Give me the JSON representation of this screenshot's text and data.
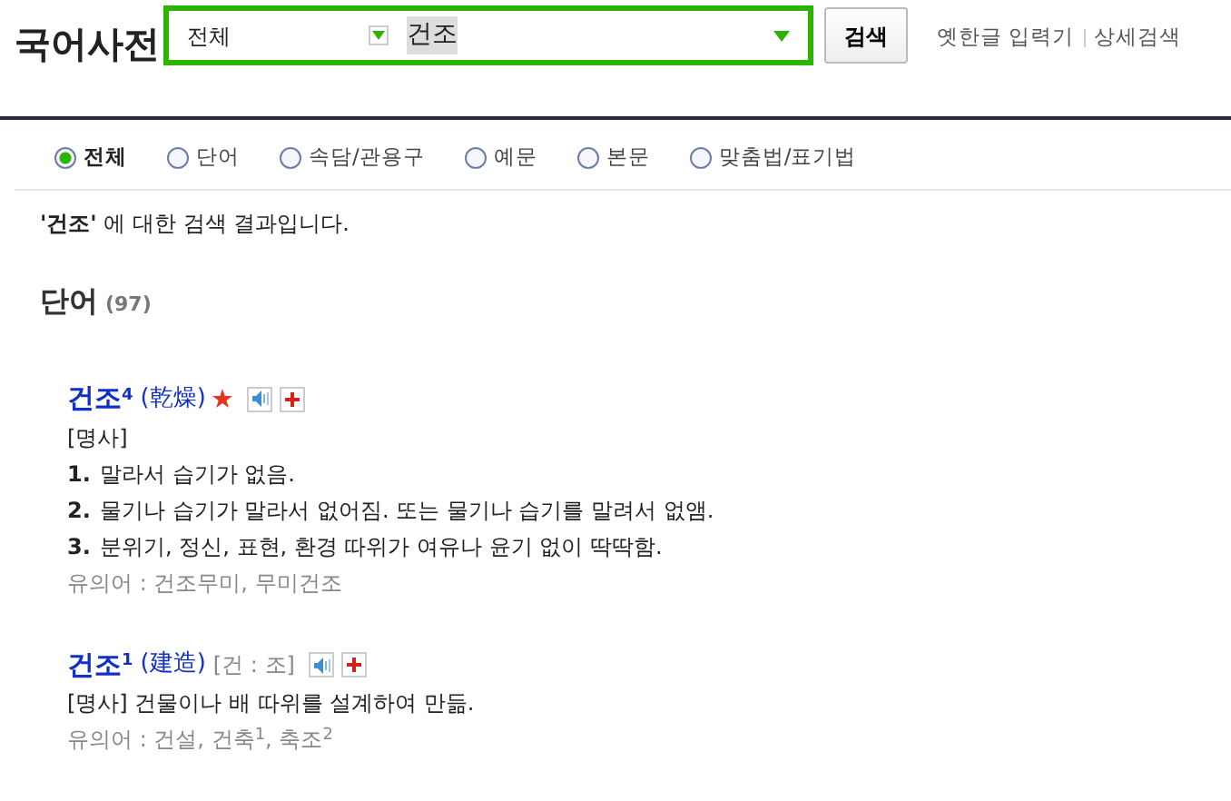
{
  "logo": "국어사전",
  "search": {
    "scope": "전체",
    "query": "건조",
    "button": "검색"
  },
  "header_links": [
    "옛한글 입력기",
    "상세검색"
  ],
  "filters": [
    {
      "label": "전체",
      "selected": true
    },
    {
      "label": "단어",
      "selected": false
    },
    {
      "label": "속담/관용구",
      "selected": false
    },
    {
      "label": "예문",
      "selected": false
    },
    {
      "label": "본문",
      "selected": false
    },
    {
      "label": "맞춤법/표기법",
      "selected": false
    }
  ],
  "summary": "**'건조'** 에 대한 검색 결과입니다.",
  "section": {
    "title": "단어",
    "count": "(97)"
  },
  "entries": [
    {
      "kind": "numbered",
      "word": "건조",
      "homonym": "4",
      "hanja": "(乾燥)",
      "starred": true,
      "pos": "[명사]",
      "definitions": [
        {
          "number": "1.",
          "text": "말라서 습기가 없음."
        },
        {
          "number": "2.",
          "text": "물기나 습기가 말라서 없어짐. 또는 물기나 습기를 말려서 없앰."
        },
        {
          "number": "3.",
          "text": "분위기, 정신, 표현, 환경 따위가 여유나 윤기 없이 딱딱함."
        }
      ],
      "synonyms": "유의어 : 건조무미, 무미건조"
    },
    {
      "kind": "single",
      "word": "건조",
      "homonym": "1",
      "hanja": "(建造)",
      "starred": false,
      "pronunciation": "[건 : 조]",
      "definition": "[명사] 건물이나 배 따위를 설계하여 만듦.",
      "synonyms": "유의어 : 건설, 건축$^{1}$, 축조$^{2}$"
    }
  ]
}
